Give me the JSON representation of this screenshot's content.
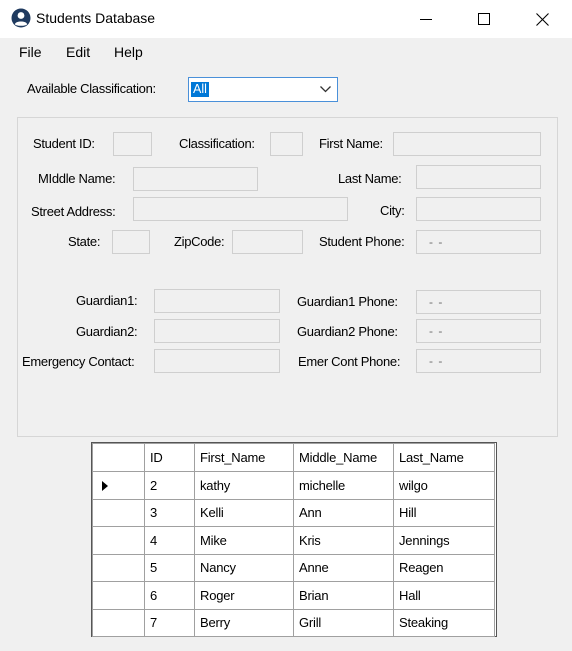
{
  "window": {
    "title": "Students Database",
    "icon": "user-circle-icon",
    "controls": [
      "minimize-icon",
      "maximize-icon",
      "close-icon"
    ]
  },
  "menu": {
    "items": [
      "File",
      "Edit",
      "Help"
    ]
  },
  "filter": {
    "label": "Available Classification:",
    "selected": "All"
  },
  "form": {
    "student_id_label": "Student ID:",
    "classification_label": "Classification:",
    "first_name_label": "First Name:",
    "middle_name_label": "MIddle Name:",
    "last_name_label": "Last Name:",
    "street_label": "Street Address:",
    "city_label": "City:",
    "state_label": "State:",
    "zip_label": "ZipCode:",
    "student_phone_label": "Student Phone:",
    "student_phone_mask": "-   -",
    "guardian1_label": "Guardian1:",
    "guardian1_phone_label": "Guardian1 Phone:",
    "guardian1_phone_mask": "-   -",
    "guardian2_label": "Guardian2:",
    "guardian2_phone_label": "Guardian2 Phone:",
    "guardian2_phone_mask": "-   -",
    "emergency_label": "Emergency Contact:",
    "emer_phone_label": "Emer Cont Phone:",
    "emer_phone_mask": "-   -"
  },
  "grid": {
    "columns": [
      "ID",
      "First_Name",
      "Middle_Name",
      "Last_Name"
    ],
    "rows": [
      [
        "2",
        "kathy",
        "michelle",
        "wilgo"
      ],
      [
        "3",
        "Kelli",
        "Ann",
        "Hill"
      ],
      [
        "4",
        "Mike",
        "Kris",
        "Jennings"
      ],
      [
        "5",
        "Nancy",
        "Anne",
        "Reagen"
      ],
      [
        "6",
        "Roger",
        "Brian",
        "Hall"
      ],
      [
        "7",
        "Berry",
        "Grill",
        "Steaking"
      ]
    ],
    "current_row_index": 0
  }
}
